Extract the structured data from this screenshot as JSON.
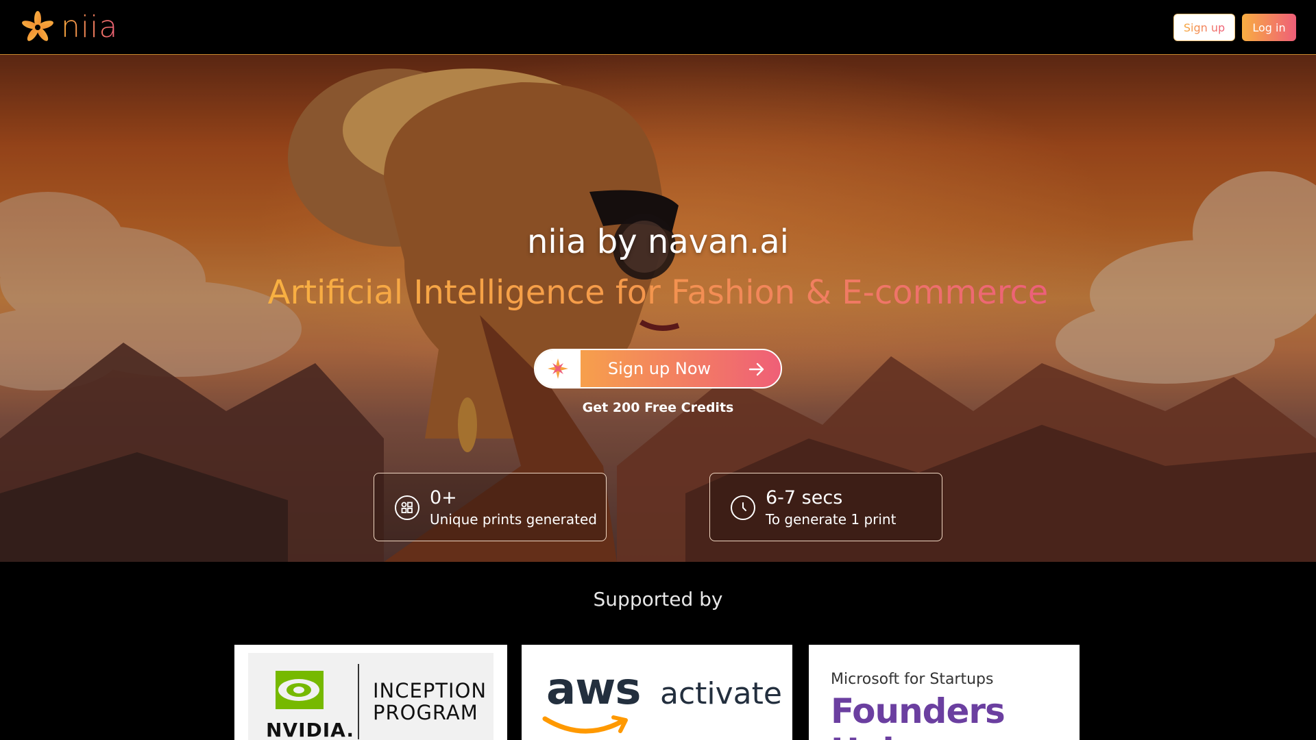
{
  "header": {
    "logo_text": "niia",
    "signup_label": "Sign up",
    "login_label": "Log in"
  },
  "hero": {
    "title": "niia by navan.ai",
    "subtitle": "Artificial Intelligence for Fashion & E-commerce",
    "cta_label": "Sign up Now",
    "cta_note": "Get 200 Free Credits"
  },
  "stats": [
    {
      "value": "0+",
      "label": "Unique prints generated",
      "icon": "prints-grid-icon"
    },
    {
      "value": "6-7 secs",
      "label": "To generate 1 print",
      "icon": "clock-icon"
    }
  ],
  "supported": {
    "title": "Supported by",
    "partners": [
      {
        "name": "nvidia",
        "lines": [
          "NVIDIA.",
          "INCEPTION",
          "PROGRAM"
        ]
      },
      {
        "name": "aws",
        "lines": [
          "aws",
          "activate"
        ]
      },
      {
        "name": "microsoft",
        "lines": [
          "Microsoft for Startups",
          "Founders Hub"
        ]
      }
    ]
  },
  "colors": {
    "brand_orange": "#f8ae42",
    "brand_pink": "#ee5e78",
    "nvidia_green": "#76b900",
    "aws_orange": "#ff9900",
    "ms_purple": "#6b3fa0"
  }
}
